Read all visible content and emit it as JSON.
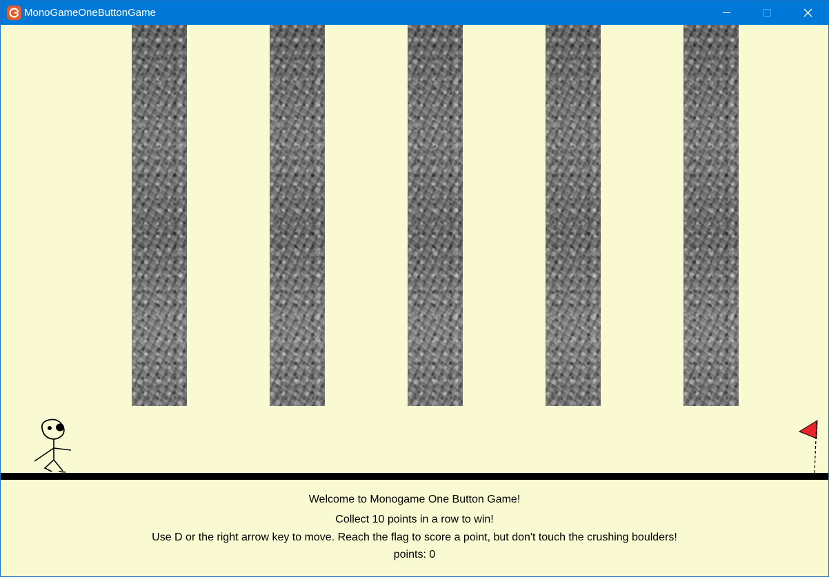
{
  "window": {
    "title": "MonoGameOneButtonGame",
    "app_icon": "monogame-logo-icon",
    "controls": [
      "minimize-icon",
      "maximize-icon",
      "close-icon"
    ]
  },
  "game": {
    "background_color": "#fafad2",
    "boulder_count": 5,
    "boulder_texture": "gray-stone",
    "player_sprite": "stick-figure",
    "goal_sprite": "red-flag",
    "flag_color": "#e8252b"
  },
  "hud": {
    "welcome": "Welcome to Monogame One Button Game!",
    "goal": "Collect 10 points in a row to win!",
    "controls": "Use D or the right arrow key to move. Reach the flag to score a point, but don't touch the crushing boulders!",
    "points_label": "points:",
    "points_value": "0"
  }
}
